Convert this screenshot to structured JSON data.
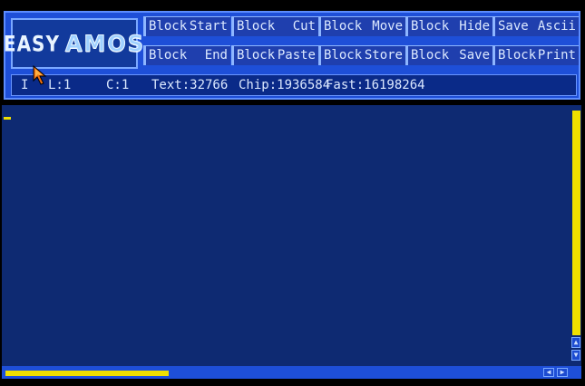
{
  "logo": {
    "easy": "EASY",
    "amos": "AMOS"
  },
  "menu": {
    "row1": [
      {
        "left": "Block",
        "right": "Start"
      },
      {
        "left": "Block",
        "right": "Cut"
      },
      {
        "left": "Block",
        "right": "Move"
      },
      {
        "left": "Block",
        "right": "Hide"
      },
      {
        "left": "Save",
        "right": "Ascii"
      }
    ],
    "row2": [
      {
        "left": "Block",
        "right": "End"
      },
      {
        "left": "Block",
        "right": "Paste"
      },
      {
        "left": "Block",
        "right": "Store"
      },
      {
        "left": "Block",
        "right": "Save"
      },
      {
        "left": "Block",
        "right": "Print"
      }
    ]
  },
  "status": {
    "mode": "I",
    "line": "L:1",
    "column": "C:1",
    "text_mem": "Text:32766",
    "chip_mem": "Chip:1936584",
    "fast_mem": "Fast:16198264"
  },
  "colors": {
    "header": "#1e4fd8",
    "editor_bg": "#0e2a72",
    "scroll_thumb": "#f0e000",
    "text": "#dce9ff"
  },
  "icons": {
    "pointer": "mouse-pointer-icon",
    "scroll_up": "arrow-up-icon",
    "scroll_down": "arrow-down-icon",
    "scroll_left": "arrow-left-icon",
    "scroll_right": "arrow-right-icon"
  }
}
